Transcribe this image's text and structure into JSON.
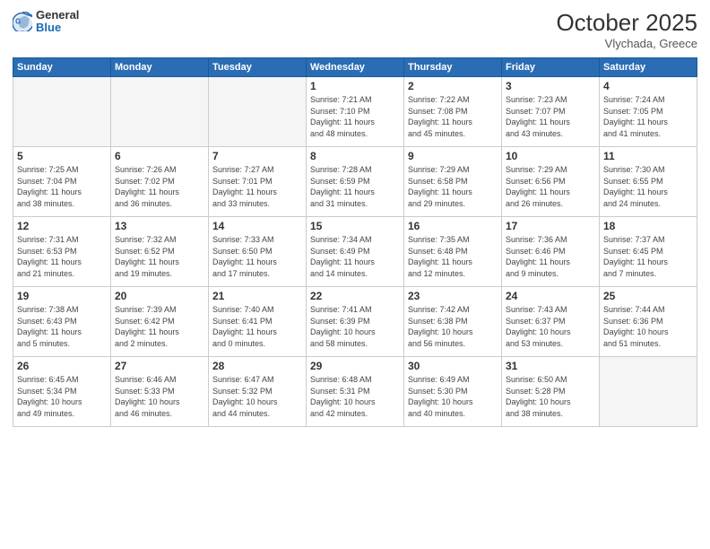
{
  "header": {
    "logo_general": "General",
    "logo_blue": "Blue",
    "month_title": "October 2025",
    "location": "Vlychada, Greece"
  },
  "days_of_week": [
    "Sunday",
    "Monday",
    "Tuesday",
    "Wednesday",
    "Thursday",
    "Friday",
    "Saturday"
  ],
  "weeks": [
    [
      {
        "day": "",
        "info": ""
      },
      {
        "day": "",
        "info": ""
      },
      {
        "day": "",
        "info": ""
      },
      {
        "day": "1",
        "info": "Sunrise: 7:21 AM\nSunset: 7:10 PM\nDaylight: 11 hours\nand 48 minutes."
      },
      {
        "day": "2",
        "info": "Sunrise: 7:22 AM\nSunset: 7:08 PM\nDaylight: 11 hours\nand 45 minutes."
      },
      {
        "day": "3",
        "info": "Sunrise: 7:23 AM\nSunset: 7:07 PM\nDaylight: 11 hours\nand 43 minutes."
      },
      {
        "day": "4",
        "info": "Sunrise: 7:24 AM\nSunset: 7:05 PM\nDaylight: 11 hours\nand 41 minutes."
      }
    ],
    [
      {
        "day": "5",
        "info": "Sunrise: 7:25 AM\nSunset: 7:04 PM\nDaylight: 11 hours\nand 38 minutes."
      },
      {
        "day": "6",
        "info": "Sunrise: 7:26 AM\nSunset: 7:02 PM\nDaylight: 11 hours\nand 36 minutes."
      },
      {
        "day": "7",
        "info": "Sunrise: 7:27 AM\nSunset: 7:01 PM\nDaylight: 11 hours\nand 33 minutes."
      },
      {
        "day": "8",
        "info": "Sunrise: 7:28 AM\nSunset: 6:59 PM\nDaylight: 11 hours\nand 31 minutes."
      },
      {
        "day": "9",
        "info": "Sunrise: 7:29 AM\nSunset: 6:58 PM\nDaylight: 11 hours\nand 29 minutes."
      },
      {
        "day": "10",
        "info": "Sunrise: 7:29 AM\nSunset: 6:56 PM\nDaylight: 11 hours\nand 26 minutes."
      },
      {
        "day": "11",
        "info": "Sunrise: 7:30 AM\nSunset: 6:55 PM\nDaylight: 11 hours\nand 24 minutes."
      }
    ],
    [
      {
        "day": "12",
        "info": "Sunrise: 7:31 AM\nSunset: 6:53 PM\nDaylight: 11 hours\nand 21 minutes."
      },
      {
        "day": "13",
        "info": "Sunrise: 7:32 AM\nSunset: 6:52 PM\nDaylight: 11 hours\nand 19 minutes."
      },
      {
        "day": "14",
        "info": "Sunrise: 7:33 AM\nSunset: 6:50 PM\nDaylight: 11 hours\nand 17 minutes."
      },
      {
        "day": "15",
        "info": "Sunrise: 7:34 AM\nSunset: 6:49 PM\nDaylight: 11 hours\nand 14 minutes."
      },
      {
        "day": "16",
        "info": "Sunrise: 7:35 AM\nSunset: 6:48 PM\nDaylight: 11 hours\nand 12 minutes."
      },
      {
        "day": "17",
        "info": "Sunrise: 7:36 AM\nSunset: 6:46 PM\nDaylight: 11 hours\nand 9 minutes."
      },
      {
        "day": "18",
        "info": "Sunrise: 7:37 AM\nSunset: 6:45 PM\nDaylight: 11 hours\nand 7 minutes."
      }
    ],
    [
      {
        "day": "19",
        "info": "Sunrise: 7:38 AM\nSunset: 6:43 PM\nDaylight: 11 hours\nand 5 minutes."
      },
      {
        "day": "20",
        "info": "Sunrise: 7:39 AM\nSunset: 6:42 PM\nDaylight: 11 hours\nand 2 minutes."
      },
      {
        "day": "21",
        "info": "Sunrise: 7:40 AM\nSunset: 6:41 PM\nDaylight: 11 hours\nand 0 minutes."
      },
      {
        "day": "22",
        "info": "Sunrise: 7:41 AM\nSunset: 6:39 PM\nDaylight: 10 hours\nand 58 minutes."
      },
      {
        "day": "23",
        "info": "Sunrise: 7:42 AM\nSunset: 6:38 PM\nDaylight: 10 hours\nand 56 minutes."
      },
      {
        "day": "24",
        "info": "Sunrise: 7:43 AM\nSunset: 6:37 PM\nDaylight: 10 hours\nand 53 minutes."
      },
      {
        "day": "25",
        "info": "Sunrise: 7:44 AM\nSunset: 6:36 PM\nDaylight: 10 hours\nand 51 minutes."
      }
    ],
    [
      {
        "day": "26",
        "info": "Sunrise: 6:45 AM\nSunset: 5:34 PM\nDaylight: 10 hours\nand 49 minutes."
      },
      {
        "day": "27",
        "info": "Sunrise: 6:46 AM\nSunset: 5:33 PM\nDaylight: 10 hours\nand 46 minutes."
      },
      {
        "day": "28",
        "info": "Sunrise: 6:47 AM\nSunset: 5:32 PM\nDaylight: 10 hours\nand 44 minutes."
      },
      {
        "day": "29",
        "info": "Sunrise: 6:48 AM\nSunset: 5:31 PM\nDaylight: 10 hours\nand 42 minutes."
      },
      {
        "day": "30",
        "info": "Sunrise: 6:49 AM\nSunset: 5:30 PM\nDaylight: 10 hours\nand 40 minutes."
      },
      {
        "day": "31",
        "info": "Sunrise: 6:50 AM\nSunset: 5:28 PM\nDaylight: 10 hours\nand 38 minutes."
      },
      {
        "day": "",
        "info": ""
      }
    ]
  ]
}
